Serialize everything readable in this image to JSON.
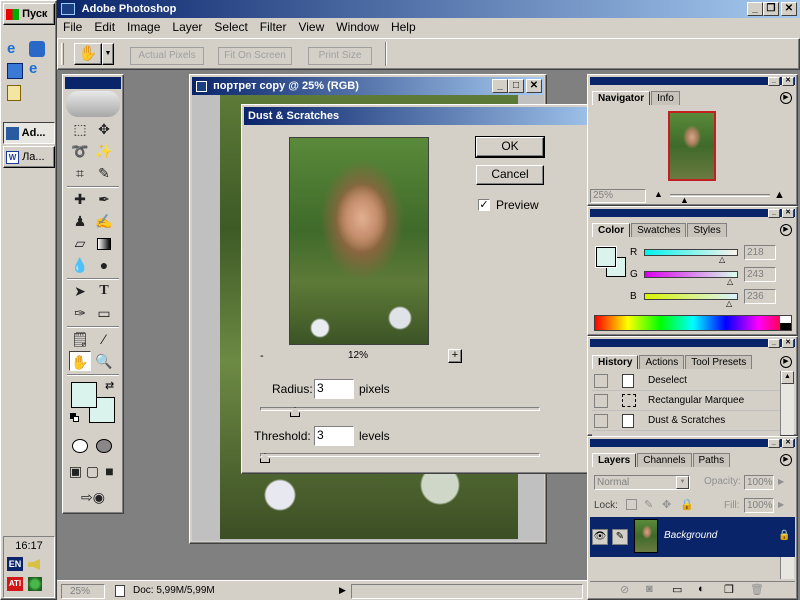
{
  "taskbar": {
    "start_label": "Пуск",
    "tasks": [
      {
        "label": "Ad..."
      },
      {
        "label": "Ла..."
      }
    ],
    "clock": "16:17",
    "lang": "EN"
  },
  "app": {
    "title": "Adobe Photoshop",
    "menu": [
      "File",
      "Edit",
      "Image",
      "Layer",
      "Select",
      "Filter",
      "View",
      "Window",
      "Help"
    ]
  },
  "options_bar": {
    "buttons": [
      "Actual Pixels",
      "Fit On Screen",
      "Print Size"
    ]
  },
  "document": {
    "title": "портрет copy @ 25% (RGB)"
  },
  "dialog": {
    "title": "Dust & Scratches",
    "ok_label": "OK",
    "cancel_label": "Cancel",
    "preview_label": "Preview",
    "preview_checked": true,
    "zoom_minus": "-",
    "zoom_value": "12%",
    "zoom_plus": "+",
    "radius_label": "Radius:",
    "radius_value": "3",
    "radius_unit": "pixels",
    "threshold_label": "Threshold:",
    "threshold_value": "3",
    "threshold_unit": "levels"
  },
  "navigator": {
    "tabs": [
      "Navigator",
      "Info"
    ],
    "zoom": "25%"
  },
  "color": {
    "tabs": [
      "Color",
      "Swatches",
      "Styles"
    ],
    "r_label": "R",
    "r_value": "218",
    "g_label": "G",
    "g_value": "243",
    "b_label": "B",
    "b_value": "236",
    "foreground": "#daf3ec"
  },
  "history": {
    "tabs": [
      "History",
      "Actions",
      "Tool Presets"
    ],
    "items": [
      "Deselect",
      "Rectangular Marquee",
      "Dust & Scratches"
    ]
  },
  "layers": {
    "tabs": [
      "Layers",
      "Channels",
      "Paths"
    ],
    "blend_mode": "Normal",
    "opacity_label": "Opacity:",
    "opacity_value": "100%",
    "lock_label": "Lock:",
    "fill_label": "Fill:",
    "fill_value": "100%",
    "layer_name": "Background"
  },
  "status": {
    "zoom": "25%",
    "doc_info": "Doc: 5,99M/5,99M"
  }
}
